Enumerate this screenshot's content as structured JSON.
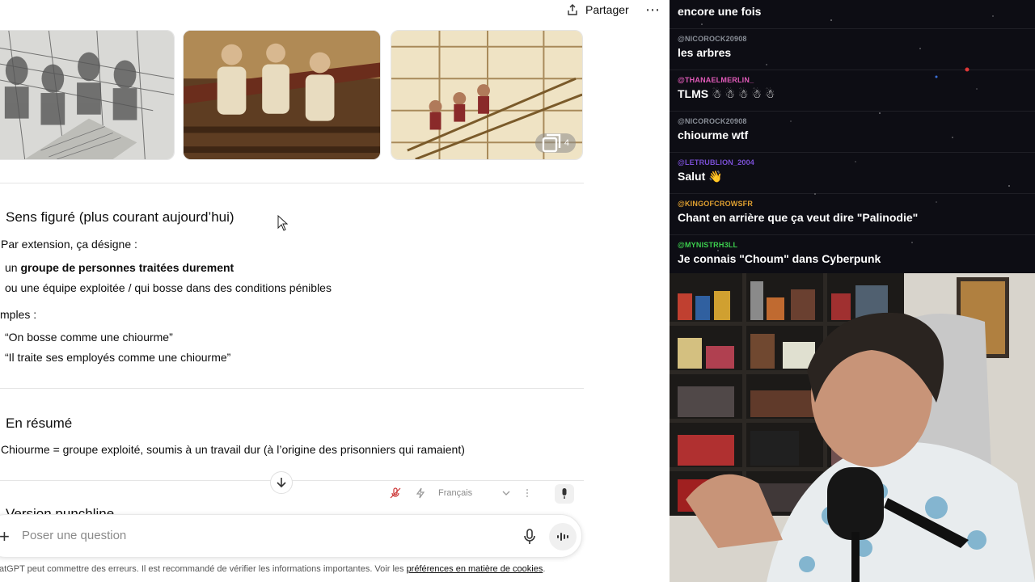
{
  "chat": {
    "share_label": "Partager",
    "more_label": "⋯",
    "image_count": "4",
    "section1": {
      "title": "Sens figuré (plus courant aujourd’hui)",
      "intro": "Par extension, ça désigne :",
      "bullet1_prefix": "un ",
      "bullet1_bold": "groupe de personnes traitées durement",
      "bullet2": "ou une équipe exploitée / qui bosse dans des conditions pénibles",
      "examples_label": "mples :",
      "example1": "“On bosse comme une chiourme”",
      "example2": "“Il traite ses employés comme une chiourme”"
    },
    "section2": {
      "title": "En résumé",
      "summary": "Chiourme = groupe exploité, soumis à un travail dur (à l’origine des prisonniers qui ramaient)"
    },
    "section3_cut_title": "Version punchline",
    "dictation": {
      "language": "Français"
    },
    "composer": {
      "placeholder": "Poser une question"
    },
    "footer": {
      "text": "atGPT peut commettre des erreurs. Il est recommandé de vérifier les informations importantes. Voir les ",
      "link": "préférences en matière de cookies",
      "end": "."
    }
  },
  "stream_chat": {
    "messages": [
      {
        "user": "",
        "text": "encore une fois",
        "color": "#ffffff"
      },
      {
        "user": "@NICOROCK20908",
        "text": "les arbres",
        "color": "#8a8f98"
      },
      {
        "user": "@THANAELMERLIN_",
        "text": "TLMS ☃ ☃ ☃ ☃ ☃",
        "color": "#e05ab8"
      },
      {
        "user": "@NICOROCK20908",
        "text": "chiourme wtf",
        "color": "#8a8f98"
      },
      {
        "user": "@LETRUBLION_2004",
        "text": "Salut 👋",
        "color": "#7a4fd6"
      },
      {
        "user": "@KINGOFCROWSFR",
        "text": "Chant en arrière que ça veut dire \"Palinodie\"",
        "color": "#e0a030"
      },
      {
        "user": "@MYNISTRH3LL",
        "text": "Je connais \"Choum\" dans Cyberpunk",
        "color": "#3ccf4e"
      }
    ]
  }
}
